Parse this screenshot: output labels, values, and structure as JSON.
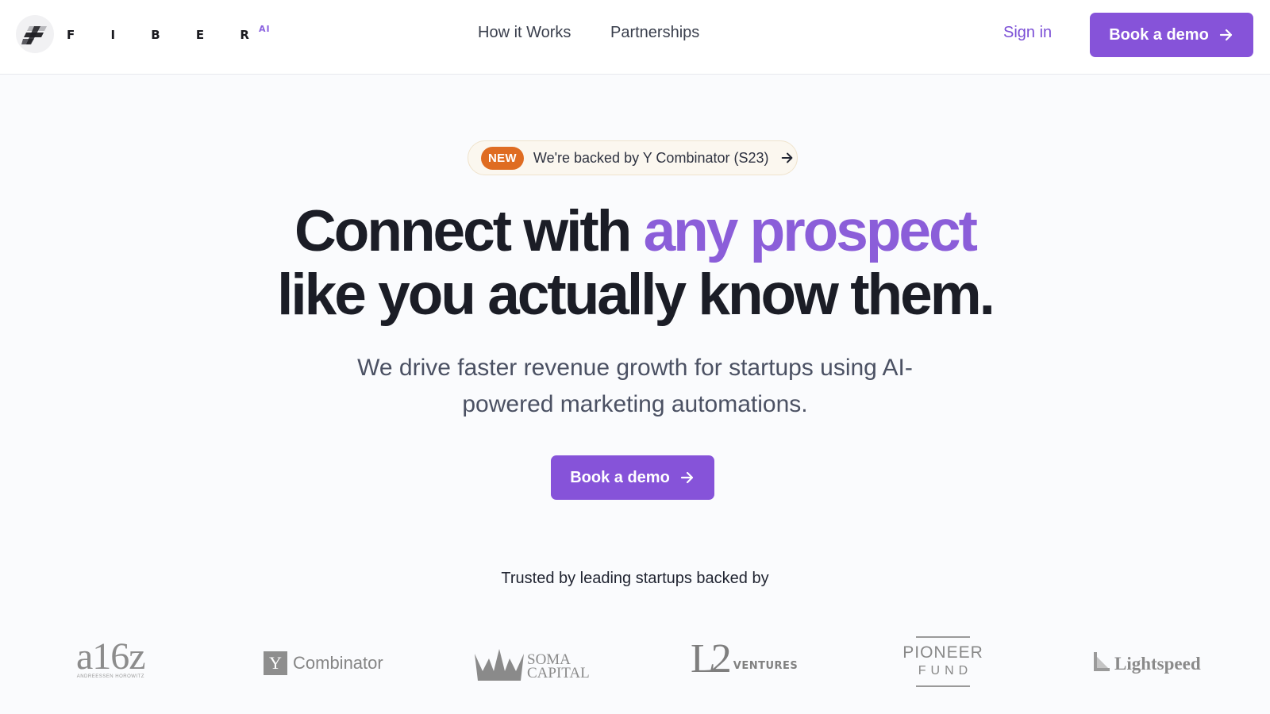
{
  "header": {
    "brand": {
      "name": "F I B E R",
      "suffix": "AI",
      "logo_icon": "fiber-logo-icon"
    },
    "nav": [
      {
        "label": "How it Works"
      },
      {
        "label": "Partnerships"
      }
    ],
    "sign_in_label": "Sign in",
    "cta_label": "Book a demo"
  },
  "hero": {
    "announcement": {
      "badge": "NEW",
      "text": "We're backed by Y Combinator (S23)",
      "icon": "arrow-right-icon"
    },
    "headline": {
      "part1": "Connect with ",
      "accent": "any prospect",
      "line2": "like you actually know them."
    },
    "subheadline": "We drive faster revenue growth for startups using AI-powered marketing automations.",
    "cta_label": "Book a demo",
    "trusted_label": "Trusted by leading startups backed by"
  },
  "investors": {
    "a16z": {
      "mark": "a16z",
      "tagline": "ANDREESSEN HOROWITZ"
    },
    "yc": {
      "box": "Y",
      "word": "Combinator"
    },
    "soma": {
      "line1": "SOMA",
      "line2": "CAPITAL"
    },
    "l2": {
      "mark": "L2",
      "word": "VENTURES"
    },
    "pioneer": {
      "line1": "PIONEER",
      "line2": "FUND"
    },
    "lightspeed": {
      "word": "Lightspeed"
    }
  },
  "colors": {
    "accent": "#8653d9",
    "badge": "#df6c22",
    "heading": "#1b1d26",
    "body_text": "#4b5163"
  }
}
